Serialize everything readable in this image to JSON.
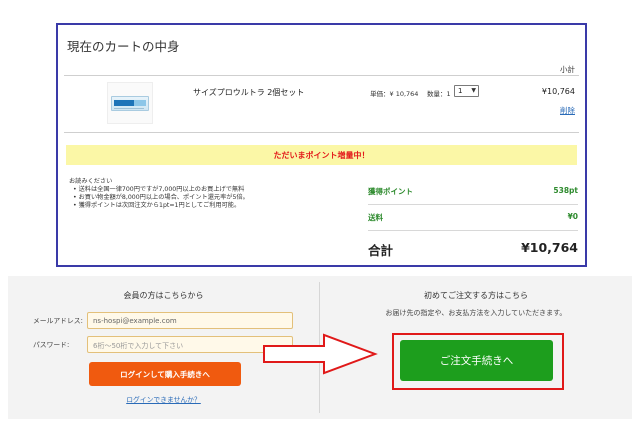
{
  "cart": {
    "title": "現在のカートの中身",
    "subtotal_header": "小計",
    "item": {
      "image_icon": "product-package-icon",
      "name": "サイズプロウルトラ 2個セット",
      "unit_price": "単価：¥ 10,764",
      "qty_label": "数量：1",
      "qty_value": "1",
      "line_total": "¥10,764",
      "delete_label": "削除"
    },
    "point_banner": "ただいまポイント増量中！",
    "notes": {
      "heading": "お読みください",
      "items": [
        "送料は全国一律700円ですが7,000円以上のお買上げで無料",
        "お買い物金額が8,000円以上の場合、ポイント還元率が5倍。",
        "獲得ポイントは次回注文から1pt=1円としてご利用可能。"
      ]
    },
    "summary": {
      "points_label": "獲得ポイント",
      "points_value": "538pt",
      "shipping_label": "送料",
      "shipping_value": "¥0",
      "total_label": "合計",
      "total_value": "¥10,764"
    }
  },
  "member": {
    "title": "会員の方はこちらから",
    "email_label": "メールアドレス:",
    "email_value": "ns-hospi@example.com",
    "password_label": "パスワード:",
    "password_placeholder": "6桁～50桁で入力して下さい",
    "login_button": "ログインして購入手続きへ",
    "forgot_link": "ログインできませんか？"
  },
  "guest": {
    "title": "初めてご注文する方はこちら",
    "description": "お届け先の指定や、お支払方法を入力していただきます。",
    "checkout_button": "ご注文手続きへ"
  },
  "colors": {
    "cart_border": "#3a3aa8",
    "banner_bg": "#fbf7a6",
    "banner_text": "#e31b1b",
    "summary_green": "#2e8b2e",
    "login_button": "#f05a0f",
    "checkout_button": "#1d9e1d",
    "highlight_red": "#e01919"
  }
}
